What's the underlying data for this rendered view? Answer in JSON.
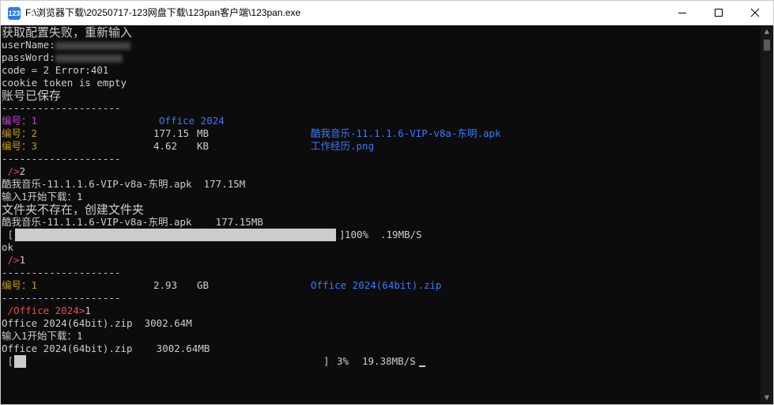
{
  "window": {
    "title": "F:\\浏览器下载\\20250717-123网盘下载\\123pan客户端\\123pan.exe",
    "icon_text": "123"
  },
  "console": {
    "l01": "获取配置失败，重新输入",
    "l02_prefix": "userName:",
    "l03_prefix": "passWord:",
    "l04": "code = 2 Error:401",
    "l05": "cookie token is empty",
    "l06": "账号已保存",
    "sep": "--------------------",
    "listing1": [
      {
        "index": "编号：1",
        "size": "",
        "unit": "",
        "name": "Office 2024",
        "index_color": "purple"
      },
      {
        "index": "编号：2",
        "size": "177.15",
        "unit": "MB",
        "name": "酷我音乐-11.1.1.6-VIP-v8a-东明.apk",
        "index_color": "yellow"
      },
      {
        "index": "编号：3",
        "size": "4.62",
        "unit": "KB",
        "name": "工作经历.png",
        "index_color": "yellow"
      }
    ],
    "prompt1": " />",
    "input1": "2",
    "sel1": "酷我音乐-11.1.1.6-VIP-v8a-东明.apk  177.15M",
    "ask1": "输入1开始下载：1",
    "mkdir": "文件夹不存在，创建文件夹",
    "dl1_name": "酷我音乐-11.1.1.6-VIP-v8a-东明.apk    177.15MB",
    "progress1": {
      "open": " [",
      "close": "]",
      "percent": "100%",
      "speed": ".19MB/S",
      "fraction": 1.0
    },
    "ok": "ok",
    "prompt2": " />",
    "input2": "1",
    "listing2": [
      {
        "index": "编号：1",
        "size": "2.93",
        "unit": "GB",
        "name": "Office 2024(64bit).zip",
        "index_color": "yellow"
      }
    ],
    "prompt3": " /Office 2024>",
    "input3": "1",
    "sel2": "Office 2024(64bit).zip  3002.64M",
    "ask2": "输入1开始下载：1",
    "dl2_name": "Office 2024(64bit).zip    3002.64MB",
    "progress2": {
      "open": " [",
      "close": "]",
      "percent": "3%",
      "speed": "19.38MB/S",
      "fraction": 0.03
    }
  },
  "colors": {
    "purple": "#b148c6",
    "yellow": "#c19c00",
    "blue": "#3b78ff",
    "red": "#e74856",
    "text": "#cccccc",
    "background": "#0c0c0c"
  },
  "icons": [
    "app-icon",
    "minimize-icon",
    "maximize-icon",
    "close-icon"
  ]
}
